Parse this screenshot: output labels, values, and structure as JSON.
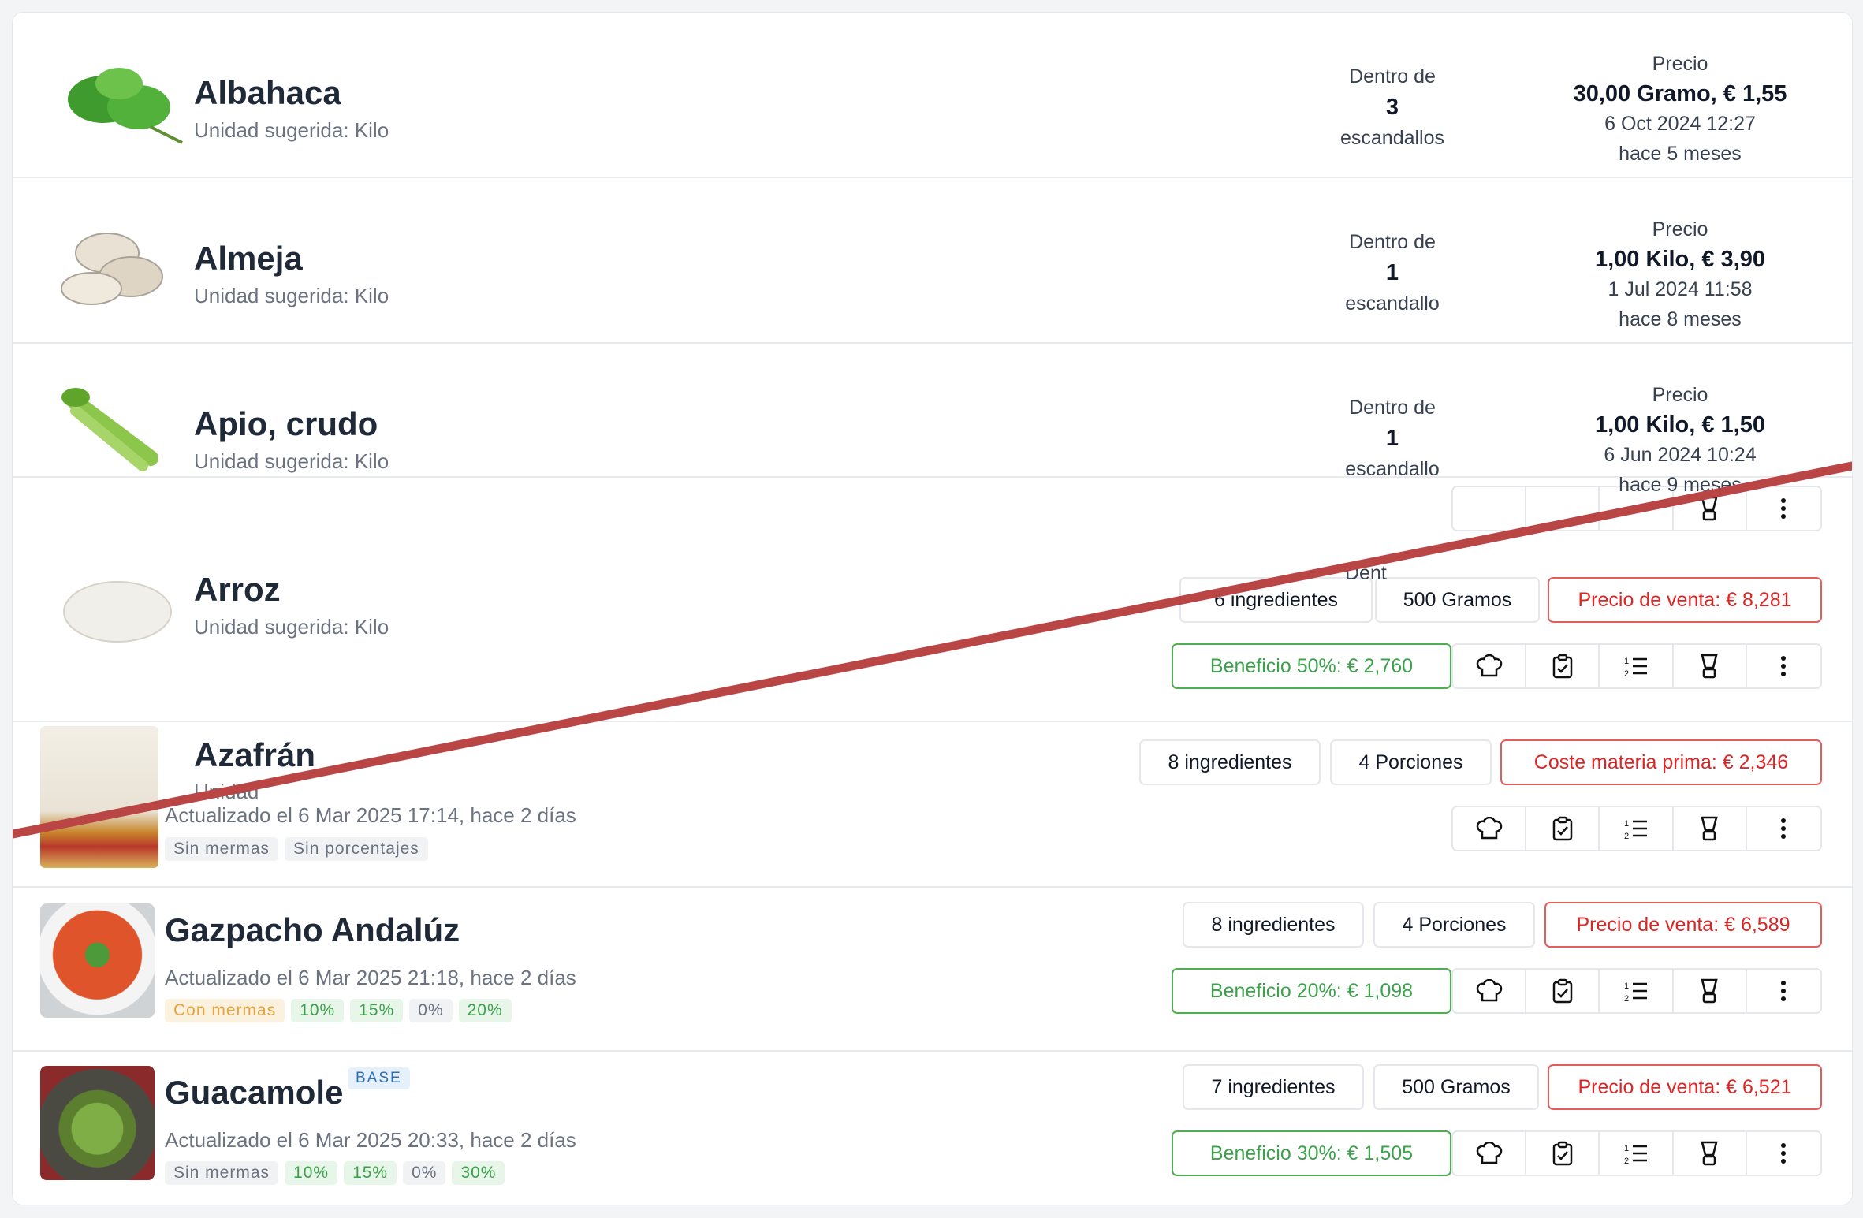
{
  "ingredients": [
    {
      "name": "Albahaca",
      "unit": "Unidad sugerida: Kilo",
      "within_label": "Dentro de",
      "within_count": "3",
      "within_unit": "escandallos",
      "price_label": "Precio",
      "price_main": "30,00 Gramo, € 1,55",
      "price_date": "6 Oct 2024 12:27",
      "price_ago": "hace 5 meses"
    },
    {
      "name": "Almeja",
      "unit": "Unidad sugerida: Kilo",
      "within_label": "Dentro de",
      "within_count": "1",
      "within_unit": "escandallo",
      "price_label": "Precio",
      "price_main": "1,00 Kilo, € 3,90",
      "price_date": "1 Jul 2024 11:58",
      "price_ago": "hace 8 meses"
    },
    {
      "name": "Apio, crudo",
      "unit": "Unidad sugerida: Kilo",
      "within_label": "Dentro de",
      "within_count": "1",
      "within_unit": "escandallo",
      "price_label": "Precio",
      "price_main": "1,00 Kilo, € 1,50",
      "price_date": "6 Jun 2024 10:24",
      "price_ago": "hace 9 meses"
    },
    {
      "name": "Arroz",
      "unit": "Unidad sugerida: Kilo",
      "within_label": "Dent"
    },
    {
      "name": "Azafrán",
      "unit": "Unidad"
    }
  ],
  "recipes": [
    {
      "ingredients": "6 ingredientes",
      "yield": "500 Gramos",
      "price": "Precio de venta: € 8,281",
      "profit": "Beneficio 50%: € 2,760"
    },
    {
      "updated": "Actualizado el 6 Mar 2025 17:14, hace 2 días",
      "tags": [
        "Sin mermas",
        "Sin porcentajes"
      ],
      "ingredients": "8 ingredientes",
      "yield": "4 Porciones",
      "price": "Coste materia prima: € 2,346"
    },
    {
      "name": "Gazpacho Andalúz",
      "updated": "Actualizado el 6 Mar 2025 21:18, hace 2 días",
      "tags": [
        "Con mermas",
        "10%",
        "15%",
        "0%",
        "20%"
      ],
      "ingredients": "8 ingredientes",
      "yield": "4 Porciones",
      "price": "Precio de venta: € 6,589",
      "profit": "Beneficio 20%: € 1,098"
    },
    {
      "name": "Guacamole",
      "badge": "BASE",
      "updated": "Actualizado el 6 Mar 2025 20:33, hace 2 días",
      "tags": [
        "Sin mermas",
        "10%",
        "15%",
        "0%",
        "30%"
      ],
      "ingredients": "7 ingredientes",
      "yield": "500 Gramos",
      "price": "Precio de venta: € 6,521",
      "profit": "Beneficio 30%: € 1,505"
    }
  ],
  "toolbar_icons": [
    "chef-hat-icon",
    "clipboard-check-icon",
    "numbered-list-icon",
    "blender-icon",
    "more-vertical-icon"
  ],
  "colors": {
    "accent_red": "#dc2626",
    "accent_green": "#3ba14a",
    "divider_line": "#b94545"
  }
}
